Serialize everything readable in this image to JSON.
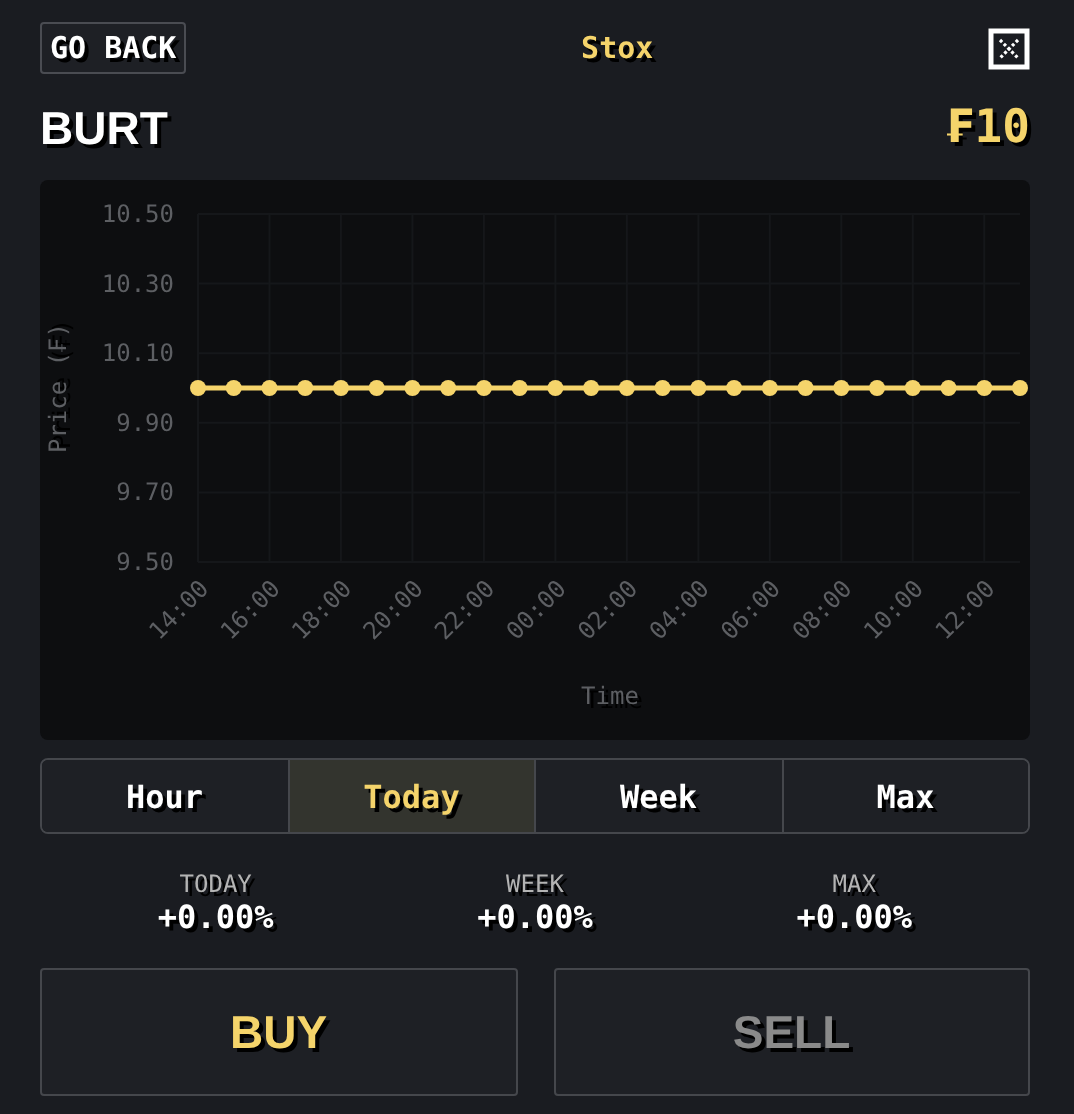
{
  "header": {
    "back_button": "GO BACK",
    "title": "Stox"
  },
  "stock": {
    "symbol": "BURT",
    "price": "₣10"
  },
  "chart": {
    "chart_data": {
      "type": "line",
      "xlabel": "Time",
      "ylabel": "Price (₣)",
      "categories": [
        "14:00",
        null,
        "16:00",
        null,
        "18:00",
        null,
        "20:00",
        null,
        "22:00",
        null,
        "00:00",
        null,
        "02:00",
        null,
        "04:00",
        null,
        "06:00",
        null,
        "08:00",
        null,
        "10:00",
        null,
        "12:00",
        null
      ],
      "grid": true,
      "series": [
        {
          "color": "#f5d46b",
          "marker": "circle",
          "values": [
            10,
            10,
            10,
            10,
            10,
            10,
            10,
            10,
            10,
            10,
            10,
            10,
            10,
            10,
            10,
            10,
            10,
            10,
            10,
            10,
            10,
            10,
            10,
            10
          ]
        }
      ],
      "ylim": [
        9.5,
        10.5
      ],
      "yticks": [
        {
          "value": 9.5,
          "label": "9.50"
        },
        {
          "value": 9.7,
          "label": "9.70"
        },
        {
          "value": 9.9,
          "label": "9.90"
        },
        {
          "value": 10.1,
          "label": "10.10"
        },
        {
          "value": 10.3,
          "label": "10.30"
        },
        {
          "value": 10.5,
          "label": "10.50"
        }
      ]
    }
  },
  "ranges": [
    {
      "label": "Hour",
      "selected": false
    },
    {
      "label": "Today",
      "selected": true
    },
    {
      "label": "Week",
      "selected": false
    },
    {
      "label": "Max",
      "selected": false
    }
  ],
  "stats": [
    {
      "label": "TODAY",
      "value": "+0.00%"
    },
    {
      "label": "WEEK",
      "value": "+0.00%"
    },
    {
      "label": "MAX",
      "value": "+0.00%"
    }
  ],
  "actions": [
    {
      "label": "BUY",
      "disabled": false
    },
    {
      "label": "SELL",
      "disabled": true
    }
  ]
}
